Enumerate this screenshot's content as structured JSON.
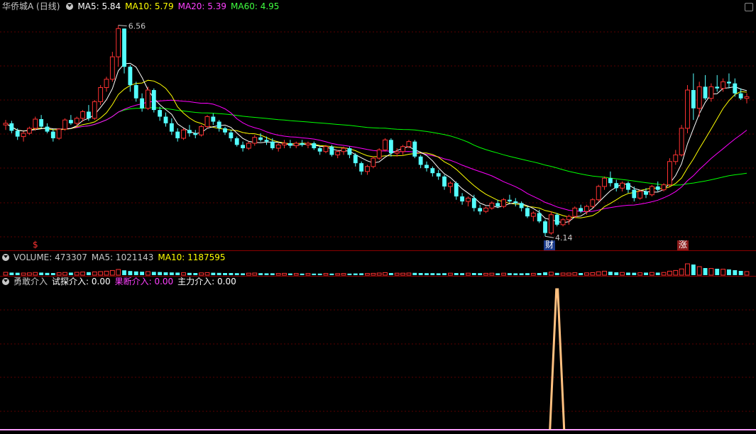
{
  "header": {
    "title": "华侨城A (日线)",
    "ma5": "MA5: 5.84",
    "ma10": "MA10: 5.79",
    "ma20": "MA20: 5.39",
    "ma60": "MA60: 4.95"
  },
  "volume_header": {
    "volume": "VOLUME: 473307",
    "ma5": "MA5: 1021143",
    "ma10": "MA10: 1187595"
  },
  "indicator_header": {
    "name": "勇敢介入",
    "trial": "试探介入: 0.00",
    "decisive": "果断介入: 0.00",
    "main": "主力介入: 0.00"
  },
  "labels": {
    "high": "6.56",
    "low": "4.14",
    "tag_left": "$",
    "tag_cai": "财",
    "tag_zhang": "涨"
  },
  "colors": {
    "up": "#ff3232",
    "down": "#54ffff",
    "ma5": "#ffffff",
    "ma10": "#ffff00",
    "ma20": "#ff00ff",
    "ma60": "#00ff00",
    "signal": "#ffc080"
  },
  "chart_data": [
    {
      "type": "candlestick",
      "title": "华侨城A (日线)",
      "ylim": [
        3.9,
        6.75
      ],
      "candles": [
        [
          5.4,
          5.46,
          5.34,
          5.42
        ],
        [
          5.42,
          5.45,
          5.3,
          5.33
        ],
        [
          5.33,
          5.36,
          5.22,
          5.26
        ],
        [
          5.26,
          5.32,
          5.2,
          5.3
        ],
        [
          5.3,
          5.38,
          5.28,
          5.36
        ],
        [
          5.36,
          5.5,
          5.33,
          5.47
        ],
        [
          5.47,
          5.52,
          5.36,
          5.38
        ],
        [
          5.38,
          5.42,
          5.3,
          5.32
        ],
        [
          5.32,
          5.35,
          5.2,
          5.24
        ],
        [
          5.24,
          5.36,
          5.22,
          5.35
        ],
        [
          5.35,
          5.48,
          5.33,
          5.46
        ],
        [
          5.46,
          5.52,
          5.4,
          5.42
        ],
        [
          5.42,
          5.5,
          5.38,
          5.48
        ],
        [
          5.48,
          5.58,
          5.44,
          5.56
        ],
        [
          5.56,
          5.64,
          5.45,
          5.48
        ],
        [
          5.48,
          5.7,
          5.46,
          5.68
        ],
        [
          5.68,
          5.88,
          5.64,
          5.85
        ],
        [
          5.85,
          5.98,
          5.8,
          5.95
        ],
        [
          5.95,
          6.28,
          5.92,
          6.22
        ],
        [
          6.22,
          6.6,
          6.1,
          6.56
        ],
        [
          6.56,
          6.56,
          6.02,
          6.1
        ],
        [
          6.1,
          6.12,
          5.8,
          5.88
        ],
        [
          5.88,
          5.92,
          5.68,
          5.72
        ],
        [
          5.72,
          5.78,
          5.56,
          5.6
        ],
        [
          5.6,
          5.86,
          5.58,
          5.82
        ],
        [
          5.82,
          5.84,
          5.55,
          5.58
        ],
        [
          5.58,
          5.62,
          5.45,
          5.5
        ],
        [
          5.5,
          5.55,
          5.38,
          5.42
        ],
        [
          5.42,
          5.48,
          5.28,
          5.32
        ],
        [
          5.32,
          5.36,
          5.2,
          5.24
        ],
        [
          5.24,
          5.36,
          5.22,
          5.34
        ],
        [
          5.34,
          5.4,
          5.26,
          5.3
        ],
        [
          5.3,
          5.34,
          5.24,
          5.28
        ],
        [
          5.28,
          5.4,
          5.26,
          5.38
        ],
        [
          5.38,
          5.52,
          5.36,
          5.5
        ],
        [
          5.5,
          5.54,
          5.4,
          5.44
        ],
        [
          5.44,
          5.46,
          5.32,
          5.36
        ],
        [
          5.36,
          5.38,
          5.28,
          5.31
        ],
        [
          5.31,
          5.34,
          5.2,
          5.24
        ],
        [
          5.24,
          5.26,
          5.14,
          5.16
        ],
        [
          5.16,
          5.2,
          5.08,
          5.12
        ],
        [
          5.12,
          5.2,
          5.1,
          5.18
        ],
        [
          5.18,
          5.28,
          5.15,
          5.25
        ],
        [
          5.25,
          5.3,
          5.2,
          5.22
        ],
        [
          5.22,
          5.26,
          5.16,
          5.2
        ],
        [
          5.2,
          5.24,
          5.1,
          5.12
        ],
        [
          5.12,
          5.18,
          5.08,
          5.16
        ],
        [
          5.16,
          5.22,
          5.12,
          5.18
        ],
        [
          5.18,
          5.22,
          5.12,
          5.15
        ],
        [
          5.15,
          5.2,
          5.12,
          5.18
        ],
        [
          5.18,
          5.22,
          5.14,
          5.16
        ],
        [
          5.16,
          5.2,
          5.12,
          5.18
        ],
        [
          5.18,
          5.2,
          5.1,
          5.12
        ],
        [
          5.12,
          5.14,
          5.04,
          5.08
        ],
        [
          5.08,
          5.16,
          5.06,
          5.14
        ],
        [
          5.14,
          5.16,
          5.02,
          5.04
        ],
        [
          5.04,
          5.1,
          5.0,
          5.08
        ],
        [
          5.08,
          5.14,
          5.04,
          5.12
        ],
        [
          5.12,
          5.14,
          5.0,
          5.04
        ],
        [
          5.04,
          5.06,
          4.9,
          4.94
        ],
        [
          4.94,
          4.96,
          4.8,
          4.84
        ],
        [
          4.84,
          4.92,
          4.8,
          4.9
        ],
        [
          4.9,
          5.02,
          4.88,
          5.0
        ],
        [
          5.0,
          5.12,
          4.98,
          5.1
        ],
        [
          5.1,
          5.24,
          5.08,
          5.22
        ],
        [
          5.22,
          5.24,
          5.02,
          5.06
        ],
        [
          5.06,
          5.12,
          5.02,
          5.08
        ],
        [
          5.08,
          5.16,
          5.04,
          5.14
        ],
        [
          5.14,
          5.22,
          5.12,
          5.2
        ],
        [
          5.2,
          5.22,
          5.0,
          5.02
        ],
        [
          5.02,
          5.04,
          4.88,
          4.92
        ],
        [
          4.92,
          4.96,
          4.84,
          4.88
        ],
        [
          4.88,
          4.9,
          4.78,
          4.82
        ],
        [
          4.82,
          4.86,
          4.74,
          4.78
        ],
        [
          4.78,
          4.8,
          4.62,
          4.66
        ],
        [
          4.66,
          4.72,
          4.58,
          4.7
        ],
        [
          4.7,
          4.72,
          4.5,
          4.54
        ],
        [
          4.54,
          4.58,
          4.44,
          4.48
        ],
        [
          4.48,
          4.54,
          4.42,
          4.52
        ],
        [
          4.52,
          4.56,
          4.36,
          4.4
        ],
        [
          4.4,
          4.44,
          4.32,
          4.36
        ],
        [
          4.36,
          4.42,
          4.34,
          4.4
        ],
        [
          4.4,
          4.48,
          4.38,
          4.46
        ],
        [
          4.46,
          4.5,
          4.4,
          4.42
        ],
        [
          4.42,
          4.52,
          4.4,
          4.5
        ],
        [
          4.5,
          4.56,
          4.46,
          4.48
        ],
        [
          4.48,
          4.52,
          4.42,
          4.46
        ],
        [
          4.46,
          4.48,
          4.36,
          4.4
        ],
        [
          4.4,
          4.42,
          4.28,
          4.3
        ],
        [
          4.3,
          4.36,
          4.24,
          4.34
        ],
        [
          4.34,
          4.38,
          4.22,
          4.24
        ],
        [
          4.24,
          4.26,
          4.06,
          4.1
        ],
        [
          4.1,
          4.36,
          4.08,
          4.32
        ],
        [
          4.32,
          4.34,
          4.18,
          4.2
        ],
        [
          4.2,
          4.28,
          4.18,
          4.26
        ],
        [
          4.26,
          4.32,
          4.2,
          4.3
        ],
        [
          4.3,
          4.42,
          4.28,
          4.4
        ],
        [
          4.4,
          4.44,
          4.34,
          4.36
        ],
        [
          4.36,
          4.44,
          4.32,
          4.42
        ],
        [
          4.42,
          4.52,
          4.4,
          4.5
        ],
        [
          4.5,
          4.68,
          4.48,
          4.66
        ],
        [
          4.66,
          4.78,
          4.62,
          4.76
        ],
        [
          4.76,
          4.84,
          4.66,
          4.7
        ],
        [
          4.7,
          4.74,
          4.6,
          4.64
        ],
        [
          4.64,
          4.72,
          4.6,
          4.7
        ],
        [
          4.7,
          4.72,
          4.58,
          4.62
        ],
        [
          4.62,
          4.66,
          4.48,
          4.52
        ],
        [
          4.52,
          4.62,
          4.5,
          4.6
        ],
        [
          4.6,
          4.64,
          4.52,
          4.56
        ],
        [
          4.56,
          4.68,
          4.54,
          4.66
        ],
        [
          4.66,
          4.72,
          4.6,
          4.62
        ],
        [
          4.62,
          4.7,
          4.6,
          4.68
        ],
        [
          4.68,
          5.0,
          4.66,
          4.96
        ],
        [
          4.96,
          5.1,
          4.92,
          5.04
        ],
        [
          5.04,
          5.4,
          5.02,
          5.36
        ],
        [
          5.36,
          5.88,
          5.3,
          5.82
        ],
        [
          5.82,
          6.02,
          5.46,
          5.6
        ],
        [
          5.6,
          5.92,
          5.5,
          5.86
        ],
        [
          5.86,
          6.0,
          5.7,
          5.72
        ],
        [
          5.72,
          5.9,
          5.68,
          5.86
        ],
        [
          5.86,
          6.0,
          5.8,
          5.84
        ],
        [
          5.84,
          5.96,
          5.8,
          5.92
        ],
        [
          5.92,
          6.02,
          5.84,
          5.9
        ],
        [
          5.9,
          5.96,
          5.74,
          5.78
        ],
        [
          5.78,
          5.84,
          5.7,
          5.72
        ],
        [
          5.72,
          5.78,
          5.66,
          5.74
        ]
      ],
      "annotations": [
        "6.56",
        "4.14"
      ]
    },
    {
      "type": "bar",
      "title": "VOLUME",
      "values": [
        40,
        36,
        34,
        30,
        32,
        38,
        36,
        32,
        30,
        34,
        38,
        36,
        40,
        44,
        42,
        46,
        50,
        56,
        66,
        80,
        68,
        58,
        52,
        48,
        50,
        46,
        44,
        40,
        38,
        36,
        34,
        32,
        30,
        32,
        36,
        34,
        32,
        30,
        30,
        28,
        26,
        28,
        30,
        28,
        26,
        26,
        24,
        26,
        24,
        24,
        22,
        24,
        22,
        22,
        24,
        22,
        22,
        24,
        22,
        24,
        26,
        24,
        26,
        30,
        36,
        30,
        28,
        28,
        30,
        32,
        30,
        28,
        28,
        26,
        28,
        28,
        30,
        28,
        28,
        30,
        28,
        26,
        28,
        26,
        28,
        28,
        26,
        26,
        28,
        26,
        30,
        40,
        42,
        32,
        30,
        30,
        34,
        30,
        32,
        36,
        48,
        56,
        48,
        40,
        38,
        36,
        34,
        34,
        36,
        38,
        36,
        38,
        56,
        66,
        88,
        160,
        150,
        120,
        100,
        94,
        90,
        84,
        80,
        70,
        60,
        50
      ],
      "ylim": [
        0,
        300
      ]
    },
    {
      "type": "line",
      "title": "勇敢介入",
      "series": [
        {
          "name": "试探介入",
          "values": []
        },
        {
          "name": "果断介入",
          "values": []
        },
        {
          "name": "主力介入",
          "values": []
        }
      ],
      "signal": {
        "index": 93,
        "value": 1
      },
      "ylim": [
        0,
        1
      ]
    }
  ]
}
